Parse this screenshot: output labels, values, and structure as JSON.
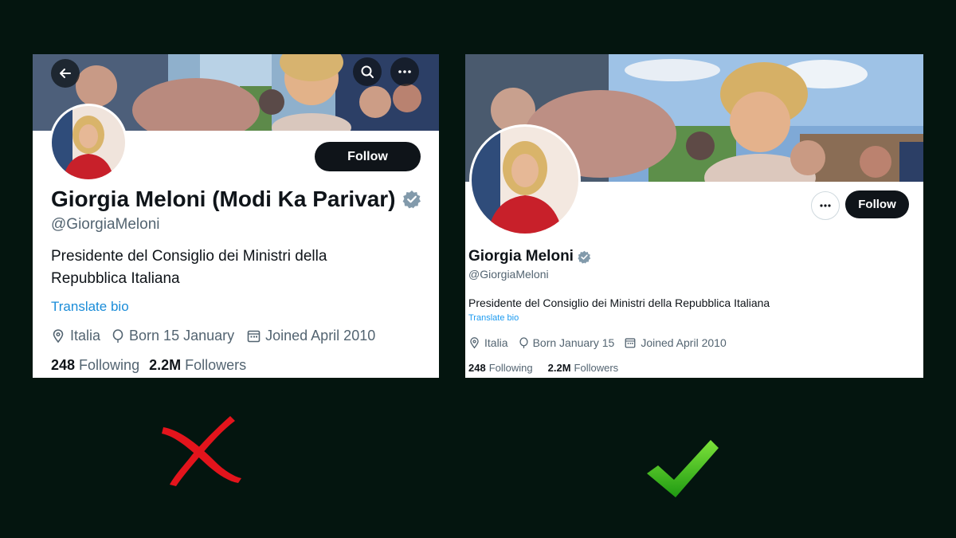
{
  "left_profile": {
    "name": "Giorgia Meloni (Modi Ka Parivar)",
    "handle": "@GiorgiaMeloni",
    "bio_line1": "Presidente del Consiglio dei Ministri della",
    "bio_line2": "Repubblica Italiana",
    "translate_label": "Translate bio",
    "location": "Italia",
    "birthday": "Born 15 January",
    "joined": "Joined April 2010",
    "following_count": "248",
    "following_label": "Following",
    "followers_count": "2.2M",
    "followers_label": "Followers",
    "follow_label": "Follow",
    "verdict_icon": "red-cross-icon"
  },
  "right_profile": {
    "name": "Giorgia Meloni",
    "handle": "@GiorgiaMeloni",
    "bio": "Presidente del Consiglio dei Ministri della Repubblica Italiana",
    "translate_label": "Translate bio",
    "location": "Italia",
    "birthday": "Born January 15",
    "joined": "Joined April 2010",
    "following_count": "248",
    "following_label": "Following",
    "followers_count": "2.2M",
    "followers_label": "Followers",
    "follow_label": "Follow",
    "verdict_icon": "green-check-icon"
  },
  "colors": {
    "background": "#04150f",
    "verified_badge": "#829aab",
    "link": "#1d9bf0",
    "cross": "#e3141c",
    "check": "#3fbf1a"
  }
}
